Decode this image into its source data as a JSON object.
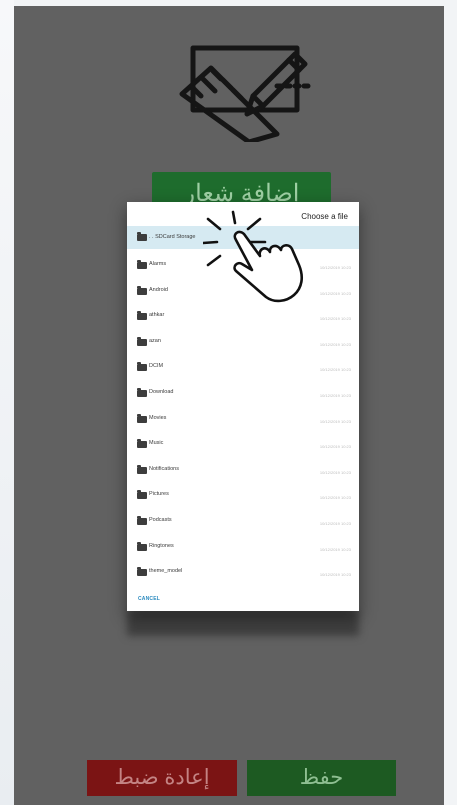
{
  "logo_section": {
    "icon": "design-ruler-pencil-icon",
    "add_logo_label": "إضافة شعار"
  },
  "file_dialog": {
    "title": "Choose a file",
    "sd_card_label": ". . SDCard Storage",
    "folders": [
      {
        "name": "Alarms",
        "meta": "10/12/2019 10:23"
      },
      {
        "name": "Android",
        "meta": "10/12/2019 10:23"
      },
      {
        "name": "athkar",
        "meta": "10/12/2019 10:23"
      },
      {
        "name": "azan",
        "meta": "10/12/2019 10:23"
      },
      {
        "name": "DCIM",
        "meta": "10/12/2019 10:23"
      },
      {
        "name": "Download",
        "meta": "10/12/2019 10:23"
      },
      {
        "name": "Movies",
        "meta": "10/12/2019 10:23"
      },
      {
        "name": "Music",
        "meta": "10/12/2019 10:23"
      },
      {
        "name": "Notifications",
        "meta": "10/12/2019 10:23"
      },
      {
        "name": "Pictures",
        "meta": "10/12/2019 10:23"
      },
      {
        "name": "Podcasts",
        "meta": "10/12/2019 10:23"
      },
      {
        "name": "Ringtones",
        "meta": "10/12/2019 10:23"
      },
      {
        "name": "theme_model",
        "meta": "10/12/2019 10:23"
      }
    ],
    "cancel_label": "CANCEL",
    "pointer_icon": "tap-hand-icon"
  },
  "bottom_bar": {
    "reset_label": "إعادة ضبط",
    "save_label": "حفظ"
  },
  "colors": {
    "overlay": "#616161",
    "save_green": "#1d5a22",
    "reset_red": "#7b1414",
    "selected_row": "#d6eaf2",
    "cancel_blue": "#2a8abf"
  }
}
